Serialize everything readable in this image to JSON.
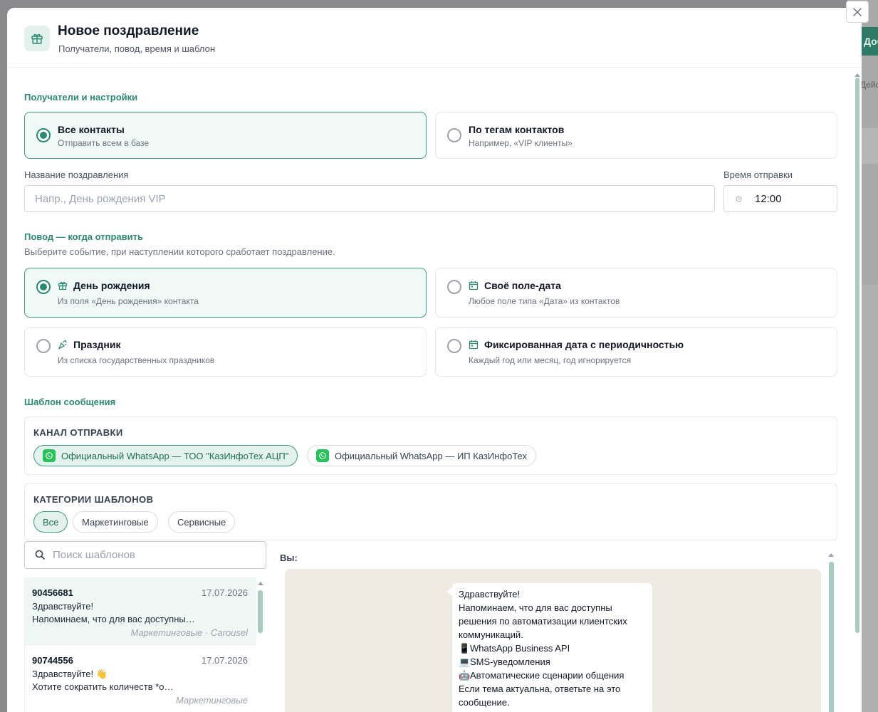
{
  "background": {
    "button_label": "Добави",
    "text": "Действия"
  },
  "modal": {
    "title": "Новое поздравление",
    "subtitle": "Получатели, повод, время и шаблон",
    "close_icon": "close-icon"
  },
  "recipients": {
    "section_title": "Получатели и настройки",
    "options": [
      {
        "title": "Все контакты",
        "subtitle": "Отправить всем в базе",
        "selected": true
      },
      {
        "title": "По тегам контактов",
        "subtitle": "Например, «VIP клиенты»",
        "selected": false
      }
    ]
  },
  "fields": {
    "name_label": "Название поздравления",
    "name_placeholder": "Напр., День рождения VIP",
    "time_label": "Время отправки",
    "time_value": "12:00"
  },
  "occasion": {
    "section_title": "Повод — когда отправить",
    "section_sub": "Выберите событие, при наступлении которого сработает поздравление.",
    "options": [
      {
        "title": "День рождения",
        "subtitle": "Из поля «День рождения» контакта",
        "icon": "gift-icon",
        "selected": true
      },
      {
        "title": "Своё поле-дата",
        "subtitle": "Любое поле типа «Дата» из контактов",
        "icon": "calendar-icon",
        "selected": false
      },
      {
        "title": "Праздник",
        "subtitle": "Из списка государственных праздников",
        "icon": "party-icon",
        "selected": false
      },
      {
        "title": "Фиксированная дата с периодичностью",
        "subtitle": "Каждый год или месяц, год игнорируется",
        "icon": "calendar-icon",
        "selected": false
      }
    ]
  },
  "template": {
    "section_title": "Шаблон сообщения",
    "channel_label": "КАНАЛ ОТПРАВКИ",
    "channels": [
      {
        "label": "Официальный WhatsApp — ТОО \"КазИнфоТех АЦП\"",
        "active": true
      },
      {
        "label": "Официальный WhatsApp — ИП КазИнфоТех",
        "active": false
      }
    ],
    "categories_label": "КАТЕГОРИИ ШАБЛОНОВ",
    "categories": [
      {
        "label": "Все",
        "active": true
      },
      {
        "label": "Маркетинговые",
        "active": false
      },
      {
        "label": "Сервисные",
        "active": false
      }
    ],
    "search_placeholder": "Поиск шаблонов",
    "items": [
      {
        "id": "90456681",
        "date": "17.07.2026",
        "line1": "Здравствуйте!",
        "line2": "Напоминаем, что для вас доступны…",
        "category": "Маркетинговые · Carousel",
        "selected": true
      },
      {
        "id": "90744556",
        "date": "17.07.2026",
        "line1": "Здравствуйте! 👋",
        "line2": "Хотите сократить количеств *о…",
        "category": "Маркетинговые",
        "selected": false
      }
    ],
    "preview_label": "Вы:",
    "preview_lines": [
      {
        "emoji": "",
        "text": "Здравствуйте!"
      },
      {
        "emoji": "",
        "text": "Напоминаем, что для вас доступны"
      },
      {
        "emoji": "",
        "text": "решения по автоматизации клиентских"
      },
      {
        "emoji": "",
        "text": "коммуникаций."
      },
      {
        "emoji": "📱",
        "text": "WhatsApp Business API"
      },
      {
        "emoji": "💻",
        "text": "SMS-уведомления"
      },
      {
        "emoji": "🤖",
        "text": "Автоматические сценарии общения"
      },
      {
        "emoji": "",
        "text": "Если тема актуальна, ответьте на это"
      },
      {
        "emoji": "",
        "text": "сообщение."
      }
    ]
  },
  "colors": {
    "accent": "#2a8a72",
    "selected_bg": "#f0f9f6",
    "whatsapp": "#25c45a",
    "chat_bg": "#efeae2"
  }
}
